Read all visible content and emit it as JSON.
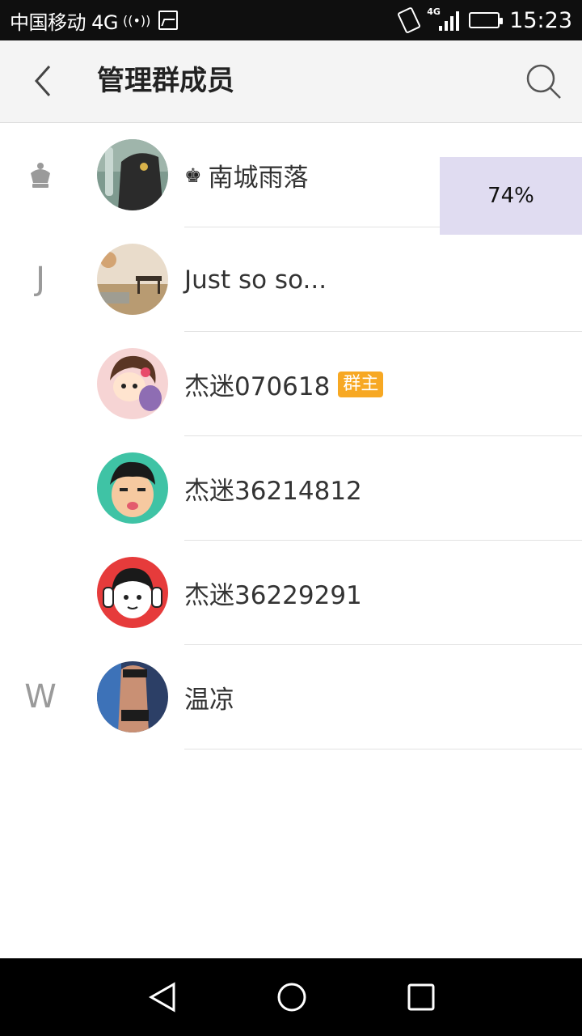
{
  "status_bar": {
    "carrier": "中国移动 4G",
    "network_badge": "4G",
    "time": "15:23",
    "icons": [
      "signal-tower-icon",
      "gallery-icon",
      "vibrate-icon",
      "cell-signal-icon",
      "battery-charging-icon"
    ],
    "battery_color": "#5fbf2e"
  },
  "header": {
    "title": "管理群成员",
    "back_icon": "chevron-left-icon",
    "search_icon": "search-icon"
  },
  "members": [
    {
      "index": "crown",
      "name": "南城雨落",
      "has_crown": true,
      "badge": ""
    },
    {
      "index": "J",
      "name": "Just so so...",
      "has_crown": false,
      "badge": ""
    },
    {
      "index": "",
      "name": "杰迷070618",
      "has_crown": false,
      "badge": "群主"
    },
    {
      "index": "",
      "name": "杰迷36214812",
      "has_crown": false,
      "badge": ""
    },
    {
      "index": "",
      "name": "杰迷36229291",
      "has_crown": false,
      "badge": ""
    },
    {
      "index": "W",
      "name": "温凉",
      "has_crown": false,
      "badge": ""
    }
  ],
  "progress": {
    "text": "74%",
    "value": 0.74
  },
  "colors": {
    "badge": "#f7a823",
    "appbar": "#f4f4f4",
    "toast": "#e0dcf1"
  },
  "nav_bar": {
    "icons": [
      "nav-back-icon",
      "nav-home-icon",
      "nav-recents-icon"
    ]
  }
}
